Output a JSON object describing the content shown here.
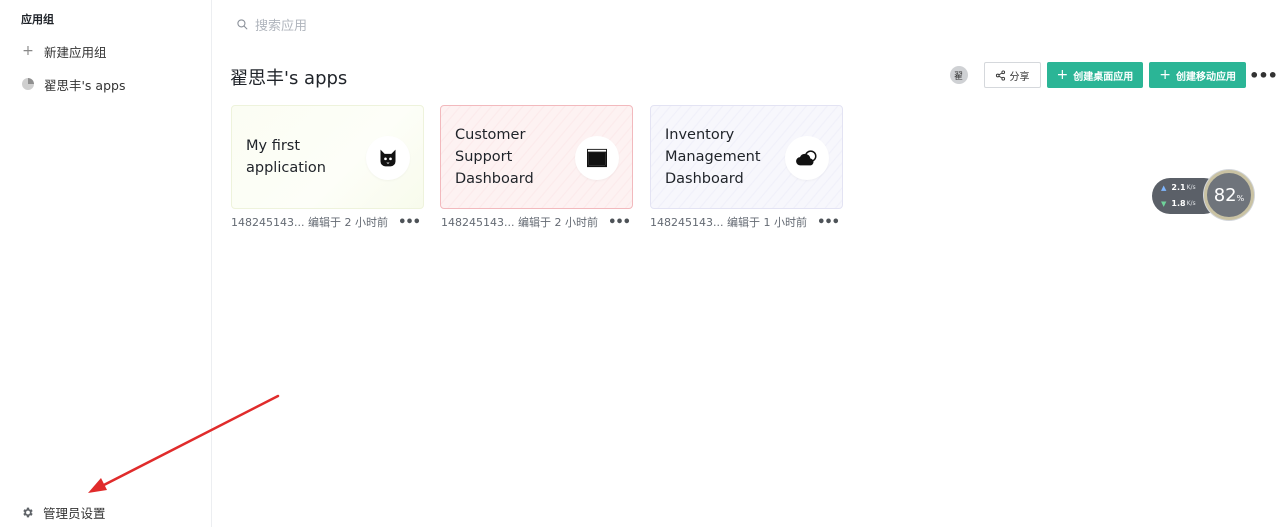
{
  "sidebar": {
    "title": "应用组",
    "items": [
      {
        "label": "新建应用组",
        "icon": "plus-icon"
      },
      {
        "label": "翟思丰's apps",
        "icon": "pie-chart-icon"
      }
    ],
    "admin_label": "管理员设置"
  },
  "search": {
    "placeholder": "搜索应用"
  },
  "main": {
    "title": "翟思丰's apps",
    "avatar_text": "翟",
    "share_label": "分享",
    "create_desktop_label": "创建桌面应用",
    "create_mobile_label": "创建移动应用",
    "more_label": "•••"
  },
  "apps": [
    {
      "name_lines": [
        "My first",
        "application"
      ],
      "icon": "cat-icon",
      "meta": "148245143... 编辑于 2 小时前",
      "more": "•••"
    },
    {
      "name_lines": [
        "Customer",
        "Support",
        "Dashboard"
      ],
      "icon": "window-icon",
      "meta": "148245143... 编辑于 2 小时前",
      "more": "•••"
    },
    {
      "name_lines": [
        "Inventory",
        "Management",
        "Dashboard"
      ],
      "icon": "cloud-icon",
      "meta": "148245143... 编辑于 1 小时前",
      "more": "•••"
    }
  ],
  "network": {
    "upload": "2.1",
    "download": "1.8",
    "unit": "K/s",
    "percent": "82",
    "percent_sign": "%"
  },
  "colors": {
    "accent": "#2bb596",
    "annotation_arrow": "#e02b2b"
  }
}
